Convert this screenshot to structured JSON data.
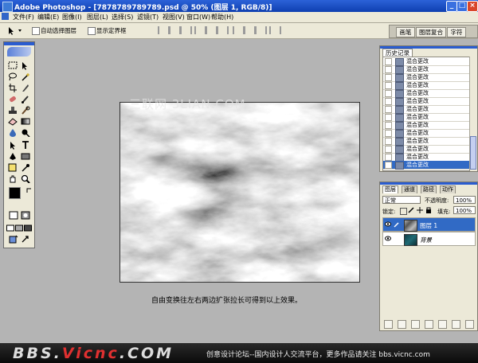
{
  "titlebar": {
    "title": "Adobe Photoshop - [7878789789789.psd @ 50% (图层 1, RGB/8)]",
    "min": "_",
    "max": "□",
    "close": "×"
  },
  "menu": [
    "文件(F)",
    "编辑(E)",
    "图像(I)",
    "图层(L)",
    "选择(S)",
    "滤镜(T)",
    "视图(V)",
    "窗口(W)",
    "帮助(H)"
  ],
  "options": {
    "auto_select": "自动选择图层",
    "show_bounds": "显示定界框"
  },
  "palette_well": {
    "tabs": [
      "画笔",
      "图层复合",
      "字符"
    ]
  },
  "canvas": {
    "watermark": "三联网 3LIAN.COM"
  },
  "caption": "自由变换往左右两边扩张拉长可得到以上效果。",
  "history": {
    "tab": "历史记录",
    "items": [
      "混合更改",
      "混合更改",
      "混合更改",
      "混合更改",
      "混合更改",
      "混合更改",
      "混合更改",
      "混合更改",
      "混合更改",
      "混合更改",
      "混合更改",
      "混合更改",
      "混合更改",
      "混合更改"
    ],
    "selected_index": 13
  },
  "layers": {
    "tabs": [
      "图层",
      "通道",
      "路径",
      "动作"
    ],
    "blend_mode": "正常",
    "opacity_label": "不透明度:",
    "opacity_value": "100%",
    "lock_label": "锁定:",
    "fill_label": "填充:",
    "fill_value": "100%",
    "items": [
      {
        "name": "图层 1",
        "active": true
      },
      {
        "name": "背景",
        "active": false
      }
    ]
  },
  "banner": {
    "logo_left": "BBS.",
    "logo_red": "Vicnc",
    "logo_right": ".COM",
    "text": "创意设计论坛--国内设计人交流平台，更多作品请关注 bbs.vicnc.com"
  },
  "colors": {
    "title_blue": "#0e3fb0",
    "selection_blue": "#316ac5",
    "panel_bg": "#ece9d8",
    "workspace": "#b4b4b4"
  }
}
